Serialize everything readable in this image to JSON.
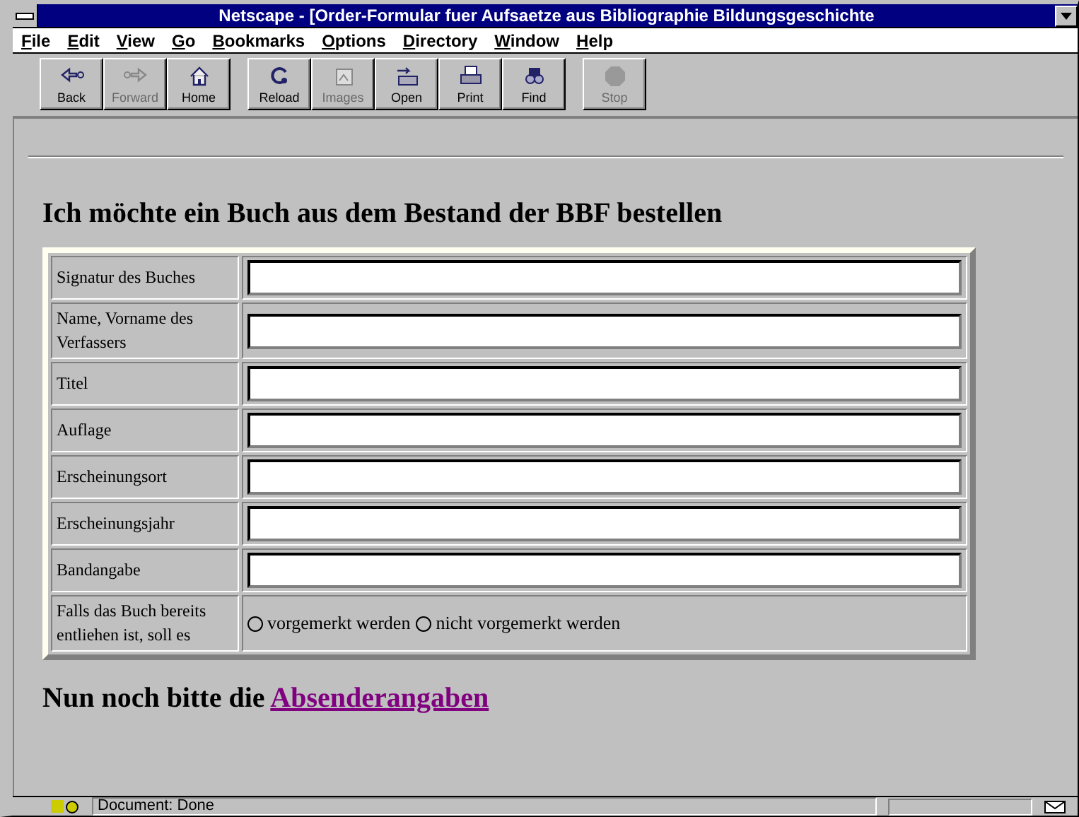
{
  "window": {
    "title": "Netscape - [Order-Formular fuer Aufsaetze aus Bibliographie Bildungsgeschichte"
  },
  "menu": [
    "File",
    "Edit",
    "View",
    "Go",
    "Bookmarks",
    "Options",
    "Directory",
    "Window",
    "Help"
  ],
  "toolbar": {
    "groups": [
      {
        "buttons": [
          {
            "label": "Back",
            "kind": "back",
            "disabled": false
          },
          {
            "label": "Forward",
            "kind": "forward",
            "disabled": true
          },
          {
            "label": "Home",
            "kind": "home",
            "disabled": false
          }
        ]
      },
      {
        "buttons": [
          {
            "label": "Reload",
            "kind": "reload",
            "disabled": false
          },
          {
            "label": "Images",
            "kind": "images",
            "disabled": true
          },
          {
            "label": "Open",
            "kind": "open",
            "disabled": false
          },
          {
            "label": "Print",
            "kind": "print",
            "disabled": false
          },
          {
            "label": "Find",
            "kind": "find",
            "disabled": false
          }
        ]
      },
      {
        "buttons": [
          {
            "label": "Stop",
            "kind": "stop",
            "disabled": true
          }
        ]
      }
    ]
  },
  "heading": "Ich möchte ein Buch aus dem Bestand der BBF bestellen",
  "form": {
    "rows": [
      {
        "label": "Signatur des Buches",
        "kind": "text"
      },
      {
        "label": "Name, Vorname des Verfassers",
        "kind": "text"
      },
      {
        "label": "Titel",
        "kind": "text"
      },
      {
        "label": "Auflage",
        "kind": "text"
      },
      {
        "label": "Erscheinungsort",
        "kind": "text"
      },
      {
        "label": "Erscheinungsjahr",
        "kind": "text"
      },
      {
        "label": "Bandangabe",
        "kind": "text"
      },
      {
        "label": "Falls das Buch bereits entliehen ist, soll es",
        "kind": "radio",
        "options": [
          {
            "label": "vorgemerkt werden",
            "selected": false
          },
          {
            "label": "nicht vorgemerkt werden",
            "selected": false
          }
        ]
      }
    ]
  },
  "footer": {
    "text": "Nun noch bitte die",
    "link": "Absenderangaben"
  },
  "status_bar": {
    "text": "Document: Done"
  }
}
